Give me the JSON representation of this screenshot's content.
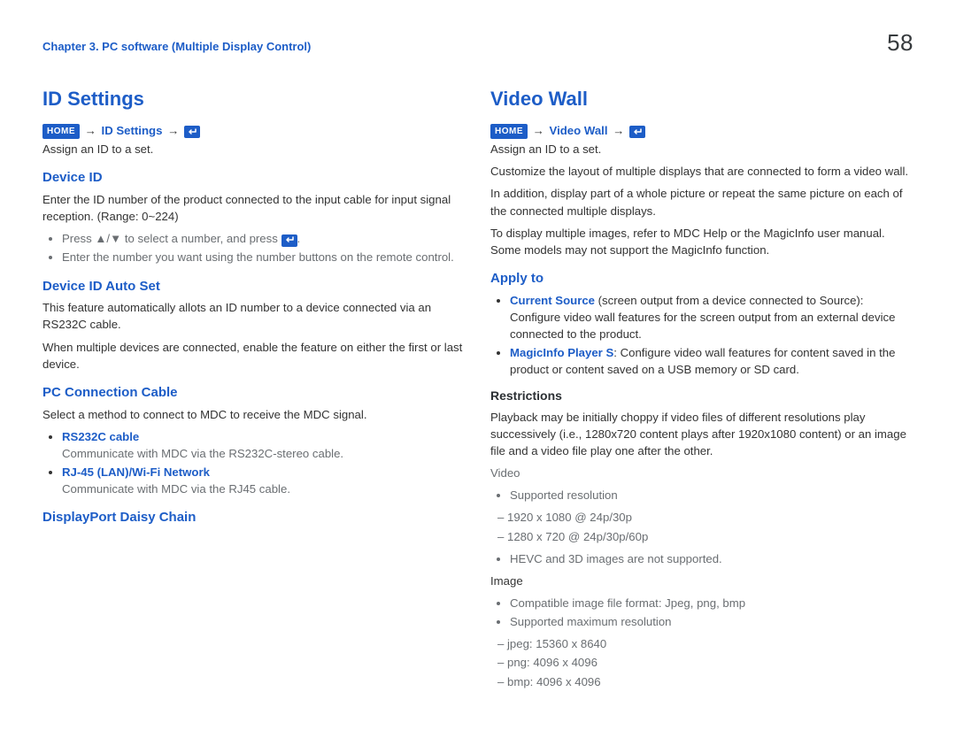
{
  "header": {
    "chapter": "Chapter 3. PC software (Multiple Display Control)",
    "page": "58"
  },
  "left": {
    "title": "ID Settings",
    "crumb_home": "HOME",
    "crumb_section": "ID Settings",
    "intro": "Assign an ID to a set.",
    "device_id": {
      "title": "Device ID",
      "body": "Enter the ID number of the product connected to the input cable for input signal reception. (Range: 0~224)",
      "b1a": "Press ",
      "b1b": "▲/▼",
      "b1c": " to select a number, and press ",
      "b1d": ".",
      "b2": "Enter the number you want using the number buttons on the remote control."
    },
    "autoset": {
      "title": "Device ID Auto Set",
      "p1": "This feature automatically allots an ID number to a device connected via an RS232C cable.",
      "p2": "When multiple devices are connected, enable the feature on either the first or last device."
    },
    "cable": {
      "title": "PC Connection Cable",
      "intro": "Select a method to connect to MDC to receive the MDC signal.",
      "i1_key": "RS232C cable",
      "i1_desc": "Communicate with MDC via the RS232C-stereo cable.",
      "i2_key1": "RJ-45 (LAN)",
      "i2_slash": "/",
      "i2_key2": "Wi-Fi Network",
      "i2_desc": "Communicate with MDC via the RJ45 cable."
    },
    "dp": {
      "title": "DisplayPort Daisy Chain"
    }
  },
  "right": {
    "title": "Video Wall",
    "crumb_home": "HOME",
    "crumb_section": "Video Wall",
    "p1": "Assign an ID to a set.",
    "p2": "Customize the layout of multiple displays that are connected to form a video wall.",
    "p3": "In addition, display part of a whole picture or repeat the same picture on each of the connected multiple displays.",
    "p4": "To display multiple images, refer to MDC Help or the MagicInfo user manual. Some models may not support the MagicInfo function.",
    "apply": {
      "title": "Apply to",
      "i1_key": "Current Source",
      "i1_rest": " (screen output from a device connected to Source): Configure video wall features for the screen output from an external device connected to the product.",
      "i2_key": "MagicInfo Player S",
      "i2_rest": ": Configure video wall features for content saved in the product or content saved on a USB memory or SD card."
    },
    "restrict": {
      "title": "Restrictions",
      "p": "Playback may be initially choppy if video files of different resolutions play successively (i.e., 1280x720 content plays after 1920x1080 content) or an image file and a video file play one after the other.",
      "video_label": "Video",
      "v_b1": "Supported resolution",
      "v_b1_s1": "1920 x 1080 @ 24p/30p",
      "v_b1_s2": "1280 x 720 @ 24p/30p/60p",
      "v_b2": "HEVC and 3D images are not supported.",
      "image_label": "Image",
      "i_b1": "Compatible image file format: Jpeg, png, bmp",
      "i_b2": "Supported maximum resolution",
      "i_b2_s1": "jpeg: 15360 x 8640",
      "i_b2_s2": "png: 4096 x 4096",
      "i_b2_s3": "bmp: 4096 x 4096"
    }
  }
}
